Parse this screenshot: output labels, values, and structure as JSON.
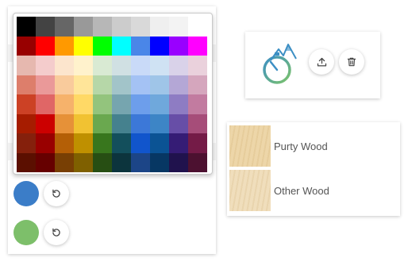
{
  "palette": {
    "rows": [
      [
        "#000000",
        "#434343",
        "#666666",
        "#999999",
        "#b7b7b7",
        "#cccccc",
        "#d9d9d9",
        "#efefef",
        "#f3f3f3",
        "#ffffff"
      ],
      [
        "#980000",
        "#ff0000",
        "#ff9900",
        "#ffff00",
        "#00ff00",
        "#00ffff",
        "#4a86e8",
        "#0000ff",
        "#9900ff",
        "#ff00ff"
      ],
      [
        "#e6b8af",
        "#f4cccc",
        "#fce5cd",
        "#fff2cc",
        "#d9ead3",
        "#d0e0e3",
        "#c9daf8",
        "#cfe2f3",
        "#d9d2e9",
        "#ead1dc"
      ],
      [
        "#dd7e6b",
        "#ea9999",
        "#f9cb9c",
        "#ffe599",
        "#b6d7a8",
        "#a2c4c9",
        "#a4c2f4",
        "#9fc5e8",
        "#b4a7d6",
        "#d5a6bd"
      ],
      [
        "#cc4125",
        "#e06666",
        "#f6b26b",
        "#ffd966",
        "#93c47d",
        "#76a5af",
        "#6d9eeb",
        "#6fa8dc",
        "#8e7cc3",
        "#c27ba0"
      ],
      [
        "#a61c00",
        "#cc0000",
        "#e69138",
        "#f1c232",
        "#6aa84f",
        "#45818e",
        "#3c78d8",
        "#3d85c6",
        "#674ea7",
        "#a64d79"
      ],
      [
        "#85200c",
        "#990000",
        "#b45f06",
        "#bf9000",
        "#38761d",
        "#134f5c",
        "#1155cc",
        "#0b5394",
        "#351c75",
        "#741b47"
      ],
      [
        "#5b0f00",
        "#660000",
        "#783f04",
        "#7f6000",
        "#274e13",
        "#0c343d",
        "#1c4587",
        "#073763",
        "#20124d",
        "#4c1130"
      ]
    ]
  },
  "selected_colors": [
    {
      "color": "#3b7dc8",
      "reset_icon": "reset-icon"
    },
    {
      "color": "#7dbf6a",
      "reset_icon": "reset-icon"
    }
  ],
  "logo_card": {
    "logo_icon": "stopwatch-mountain-logo",
    "upload_icon": "upload-icon",
    "delete_icon": "trash-icon"
  },
  "wood_options": [
    {
      "label": "Purty Wood",
      "color": "#ecd4a4"
    },
    {
      "label": "Other Wood",
      "color": "#efdcb8"
    }
  ]
}
